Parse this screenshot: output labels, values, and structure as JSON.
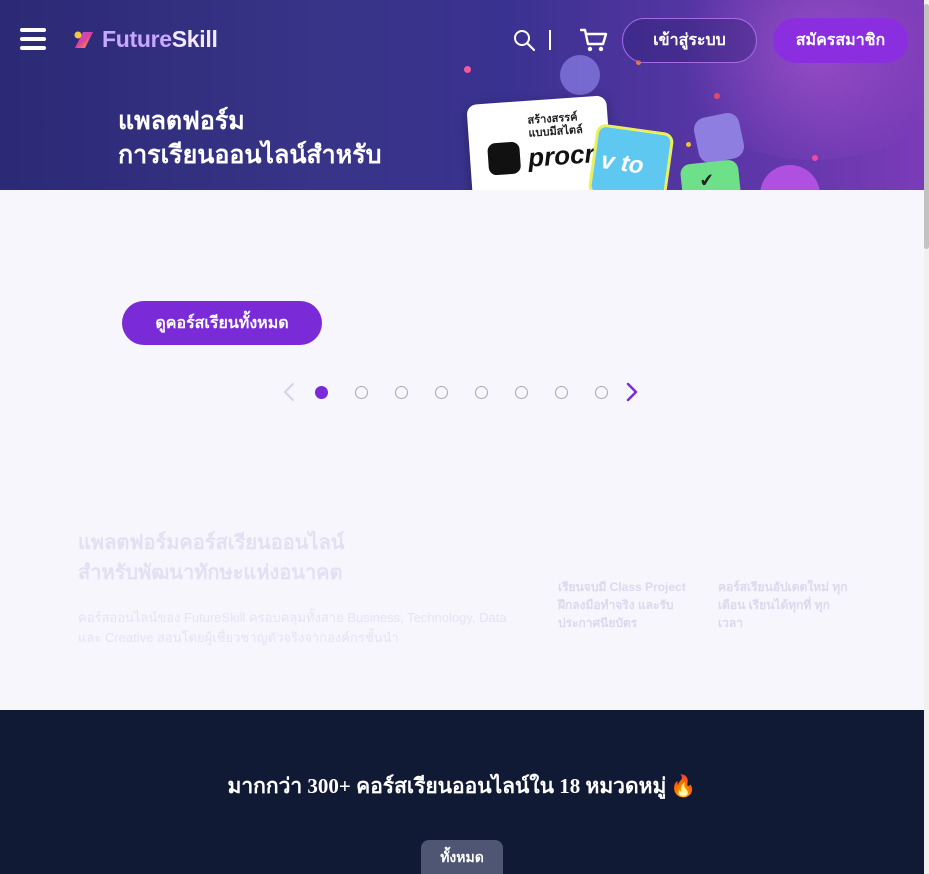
{
  "header": {
    "brand_future": "Future",
    "brand_skill": "Skill",
    "login_label": "เข้าสู่ระบบ",
    "signup_label": "สมัครสมาชิก"
  },
  "hero": {
    "title_line1": "แพลตฟอร์ม",
    "title_line2": "การเรียนออนไลน์สำหรับ",
    "card_tag_line1": "สร้างสรรค์",
    "card_tag_line2": "แบบมีสไตล์",
    "card_word": "procre",
    "card_word2": "v to"
  },
  "cta": {
    "label": "ดูคอร์สเรียนทั้งหมด"
  },
  "carousel": {
    "slide_count": 8,
    "active_index": 0,
    "accent": "#7a2ad6"
  },
  "faded_section": {
    "title_line1": "แพลตฟอร์มคอร์สเรียนออนไลน์",
    "title_line2": "สำหรับพัฒนาทักษะแห่งอนาคต",
    "description": "คอร์สออนไลน์ของ FutureSkill ครอบคลุมทั้งสาย Business, Technology, Data และ Creative สอนโดยผู้เชี่ยวชาญตัวจริงจากองค์กรชั้นนำ",
    "col1": "เรียนจบมี Class Project ฝึกลงมือทำจริง และรับ ประกาศนียบัตร",
    "col2": "คอร์สเรียนอัปเดตใหม่ ทุกเดือน เรียนได้ทุกที่ ทุกเวลา"
  },
  "catalog": {
    "heading": "มากกว่า 300+ คอร์สเรียนออนไลน์ใน 18 หมวดหมู่",
    "fire_glyph": "🔥",
    "tab_all": "ทั้งหมด"
  },
  "colors": {
    "brand_purple": "#8a2ee0",
    "dark_bg": "#111a35"
  }
}
